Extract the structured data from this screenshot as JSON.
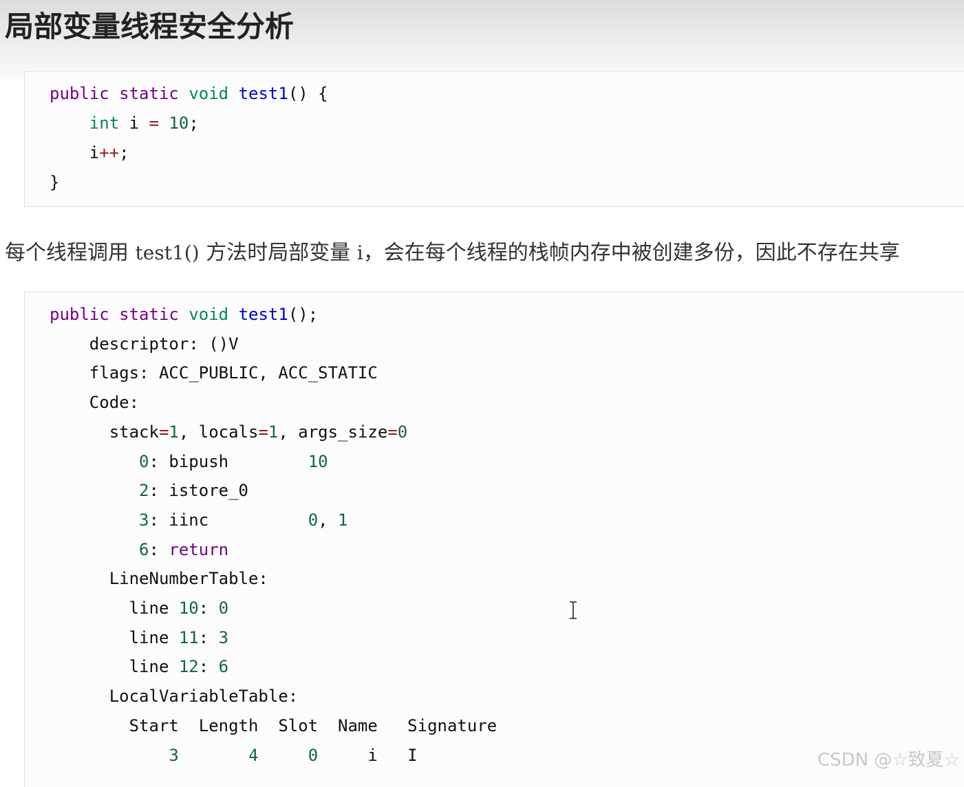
{
  "heading": {
    "title": "局部变量线程安全分析"
  },
  "code_block_1": {
    "lines": [
      [
        [
          "k",
          "public"
        ],
        [
          "p",
          " "
        ],
        [
          "k",
          "static"
        ],
        [
          "p",
          " "
        ],
        [
          "t",
          "void"
        ],
        [
          "p",
          " "
        ],
        [
          "f",
          "test1"
        ],
        [
          "p",
          "() {"
        ]
      ],
      [
        [
          "p",
          "    "
        ],
        [
          "t",
          "int"
        ],
        [
          "p",
          " i "
        ],
        [
          "o",
          "="
        ],
        [
          "p",
          " "
        ],
        [
          "n",
          "10"
        ],
        [
          "p",
          ";"
        ]
      ],
      [
        [
          "p",
          "    i"
        ],
        [
          "o",
          "++"
        ],
        [
          "p",
          ";"
        ]
      ],
      [
        [
          "p",
          "}"
        ]
      ]
    ]
  },
  "paragraph": {
    "before": "每个线程调用 ",
    "code_method": "test1()",
    "middle": " 方法时局部变量 ",
    "code_var": "i",
    "after": "，会在每个线程的栈帧内存中被创建多份，因此不存在共享"
  },
  "code_block_2": {
    "lines": [
      [
        [
          "k",
          "public"
        ],
        [
          "p",
          " "
        ],
        [
          "k",
          "static"
        ],
        [
          "p",
          " "
        ],
        [
          "t",
          "void"
        ],
        [
          "p",
          " "
        ],
        [
          "f",
          "test1"
        ],
        [
          "p",
          "();"
        ]
      ],
      [
        [
          "p",
          "    descriptor: ()V"
        ]
      ],
      [
        [
          "p",
          "    flags: ACC_PUBLIC, ACC_STATIC"
        ]
      ],
      [
        [
          "p",
          "    Code:"
        ]
      ],
      [
        [
          "p",
          "      stack"
        ],
        [
          "o",
          "="
        ],
        [
          "n",
          "1"
        ],
        [
          "p",
          ", locals"
        ],
        [
          "o",
          "="
        ],
        [
          "n",
          "1"
        ],
        [
          "p",
          ", args_size"
        ],
        [
          "o",
          "="
        ],
        [
          "n",
          "0"
        ]
      ],
      [
        [
          "p",
          "         "
        ],
        [
          "n",
          "0"
        ],
        [
          "p",
          ": bipush        "
        ],
        [
          "n",
          "10"
        ]
      ],
      [
        [
          "p",
          "         "
        ],
        [
          "n",
          "2"
        ],
        [
          "p",
          ": istore_0"
        ]
      ],
      [
        [
          "p",
          "         "
        ],
        [
          "n",
          "3"
        ],
        [
          "p",
          ": iinc          "
        ],
        [
          "n",
          "0"
        ],
        [
          "p",
          ", "
        ],
        [
          "n",
          "1"
        ]
      ],
      [
        [
          "p",
          "         "
        ],
        [
          "n",
          "6"
        ],
        [
          "p",
          ": "
        ],
        [
          "r",
          "return"
        ]
      ],
      [
        [
          "p",
          "      LineNumberTable:"
        ]
      ],
      [
        [
          "p",
          "        line "
        ],
        [
          "n",
          "10"
        ],
        [
          "p",
          ": "
        ],
        [
          "n",
          "0"
        ]
      ],
      [
        [
          "p",
          "        line "
        ],
        [
          "n",
          "11"
        ],
        [
          "p",
          ": "
        ],
        [
          "n",
          "3"
        ]
      ],
      [
        [
          "p",
          "        line "
        ],
        [
          "n",
          "12"
        ],
        [
          "p",
          ": "
        ],
        [
          "n",
          "6"
        ]
      ],
      [
        [
          "p",
          "      LocalVariableTable:"
        ]
      ],
      [
        [
          "p",
          "        Start  Length  Slot  Name   Signature"
        ]
      ],
      [
        [
          "p",
          "            "
        ],
        [
          "n",
          "3"
        ],
        [
          "p",
          "       "
        ],
        [
          "n",
          "4"
        ],
        [
          "p",
          "     "
        ],
        [
          "n",
          "0"
        ],
        [
          "p",
          "     i   I"
        ]
      ]
    ]
  },
  "cursor": {
    "icon": "text-cursor-icon"
  },
  "watermark": {
    "text": "CSDN @☆致夏☆"
  },
  "colors": {
    "keyword": "#770088",
    "type": "#008855",
    "function": "#0000cc",
    "operator": "#981a1a",
    "number": "#116644",
    "plain": "#111111"
  }
}
